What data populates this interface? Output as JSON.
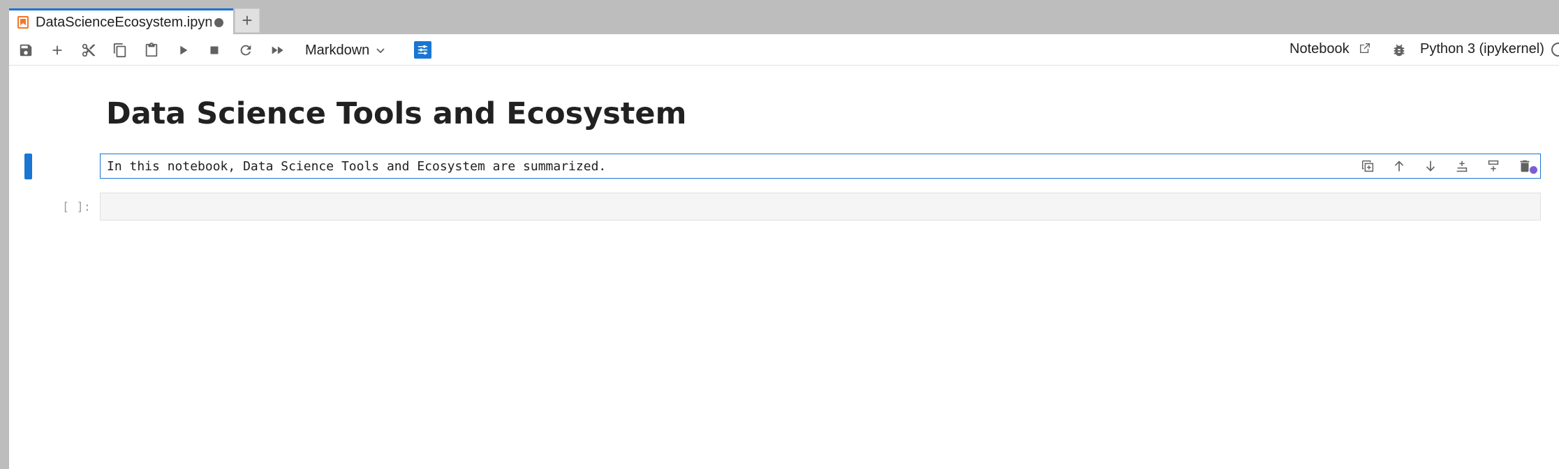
{
  "tabbar": {
    "tab_title": "DataScienceEcosystem.ipynb",
    "new_tab_label": "+"
  },
  "toolbar": {
    "cell_type": "Markdown",
    "notebook_label": "Notebook",
    "kernel_label": "Python 3 (ipykernel)",
    "icons": [
      "save-icon",
      "add-cell-icon",
      "cut-icon",
      "copy-icon",
      "paste-icon",
      "run-icon",
      "stop-icon",
      "restart-icon",
      "run-all-icon"
    ]
  },
  "notebook": {
    "heading": "Data Science Tools and Ecosystem",
    "active_cell_text": "In this notebook, Data Science Tools and Ecosystem are summarized.",
    "empty_cell_prompt": "[ ]:",
    "cell_tools": [
      "duplicate-icon",
      "move-up-icon",
      "move-down-icon",
      "insert-above-icon",
      "insert-below-icon",
      "delete-icon"
    ]
  },
  "colors": {
    "accent": "#1976d2",
    "tab_icon": "#f37726",
    "badge": "#7b5cd6"
  }
}
